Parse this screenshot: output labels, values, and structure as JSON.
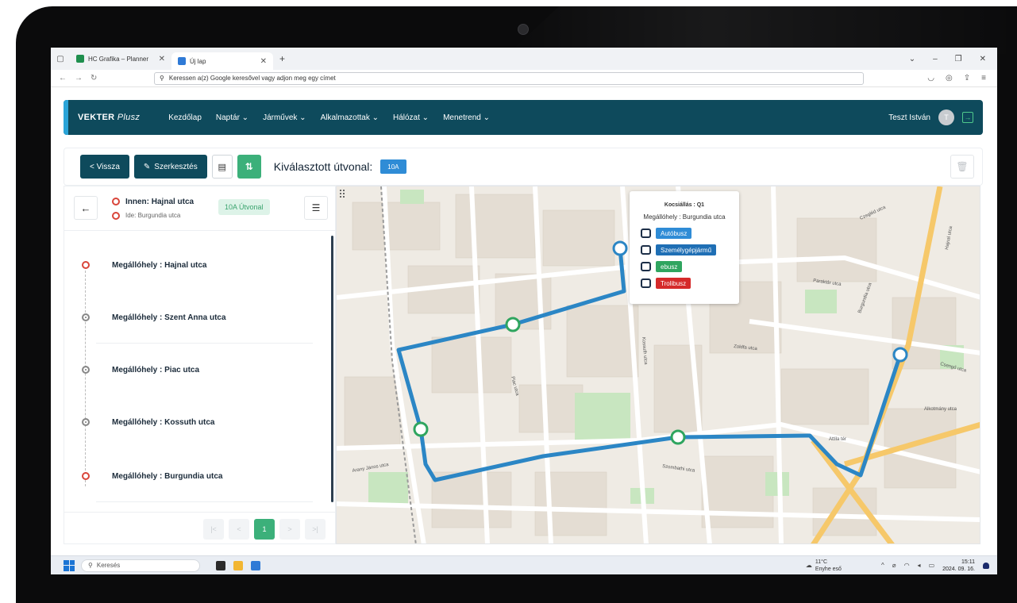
{
  "browser": {
    "tabs": [
      {
        "title": "HC Grafika – Planner",
        "favicon_color": "#1f8f4e"
      },
      {
        "title": "Új lap",
        "favicon_color": "#2f7ad6"
      }
    ],
    "new_tab": "+",
    "address_placeholder": "Keressen a(z) Google keresővel vagy adjon meg egy címet"
  },
  "app": {
    "logo_bold": "VEKTER",
    "logo_light": "Plusz",
    "menu": [
      {
        "label": "Kezdőlap"
      },
      {
        "label": "Naptár ⌄"
      },
      {
        "label": "Járművek ⌄"
      },
      {
        "label": "Alkalmazottak ⌄"
      },
      {
        "label": "Hálózat ⌄"
      },
      {
        "label": "Menetrend ⌄"
      }
    ],
    "user_name": "Teszt István",
    "avatar_initial": "T",
    "brand_color": "#0e4a5c",
    "accent_green": "#3cb07a"
  },
  "toolbar": {
    "back_label": "< Vissza",
    "edit_label": "Szerkesztés",
    "selected_route_label": "Kiválasztott útvonal:",
    "route_badge": "10A"
  },
  "panel": {
    "from": "Innen: Hajnal utca",
    "to": "Ide: Burgundia utca",
    "route_chip": "10A Útvonal",
    "stops": [
      {
        "label": "Megállóhely : Hajnal utca",
        "marker": "red"
      },
      {
        "label": "Megállóhely : Szent Anna utca",
        "marker": "grey"
      },
      {
        "label": "Megállóhely : Piac utca",
        "marker": "grey"
      },
      {
        "label": "Megállóhely : Kossuth utca",
        "marker": "grey"
      },
      {
        "label": "Megállóhely : Burgundia utca",
        "marker": "red"
      }
    ],
    "pager": {
      "first": "|<",
      "prev": "<",
      "current": "1",
      "next": ">",
      "last": ">|"
    }
  },
  "map": {
    "popup": {
      "title": "Kocsiállás : Q1",
      "subtitle": "Megállóhely : Burgundia utca",
      "vehicles": [
        {
          "label": "Autóbusz",
          "color": "#2f8cd6"
        },
        {
          "label": "Személygépjármű",
          "color": "#1f6fb5"
        },
        {
          "label": "ebusz",
          "color": "#2fa55f"
        },
        {
          "label": "Trolibusz",
          "color": "#d52a2a"
        }
      ]
    },
    "street_labels": [
      "Piac utca",
      "Kossuth utca",
      "Paraktár utca",
      "Zoldfa utca",
      "Szombathi utca",
      "Arany János utca",
      "Attila tér",
      "Czegléd utca",
      "Hajnal utca",
      "Burgundia utca",
      "Alkotmány utca",
      "Csengő utca"
    ],
    "route_color": "#2b86c5"
  },
  "taskbar": {
    "search": "Keresés",
    "weather_temp": "11°C",
    "weather_desc": "Enyhe eső",
    "time": "15:11",
    "date": "2024. 09. 16."
  }
}
